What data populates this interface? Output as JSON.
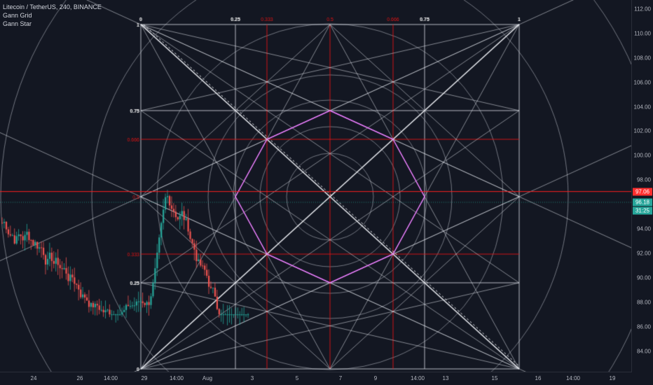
{
  "legend": {
    "title": "Litecoin / TetherUS, 240, BINANCE",
    "indicator_1": "Gann Grid",
    "indicator_2": "Gann Star"
  },
  "colors": {
    "background": "#131722",
    "bull": "#26a69a",
    "bear": "#ef5350",
    "grid_line": "#c8ccd6",
    "red_line": "#e31414",
    "magenta": "#e040fb",
    "price_line": "#ff1f1f",
    "last_price_line": "#26a69a"
  },
  "price_axis": {
    "ticks": [
      "112.00",
      "110.00",
      "108.00",
      "106.00",
      "104.00",
      "102.00",
      "100.00",
      "98.00",
      "94.00",
      "92.00",
      "90.00",
      "88.00",
      "86.00",
      "84.00"
    ],
    "tick_values": [
      112,
      110,
      108,
      106,
      104,
      102,
      100,
      98,
      94,
      92,
      90,
      88,
      86,
      84
    ],
    "current_price": "97.06",
    "current_price_value": 97.06,
    "last_price": "96.18",
    "last_price_value": 96.18,
    "countdown": "31:25"
  },
  "time_axis": {
    "labels": [
      "24",
      "26",
      "14:00",
      "29",
      "14:00",
      "Aug",
      "3",
      "5",
      "7",
      "9",
      "14:00",
      "13",
      "15",
      "16",
      "14:00",
      "19"
    ]
  },
  "gann_grid": {
    "top_labels": [
      "0",
      "0.25",
      "0.333",
      "0.5",
      "0.666",
      "0.75",
      "1"
    ],
    "left_labels": [
      "1",
      "0.75",
      "0.666",
      "0.5",
      "0.333",
      "0.25",
      "0"
    ]
  }
}
